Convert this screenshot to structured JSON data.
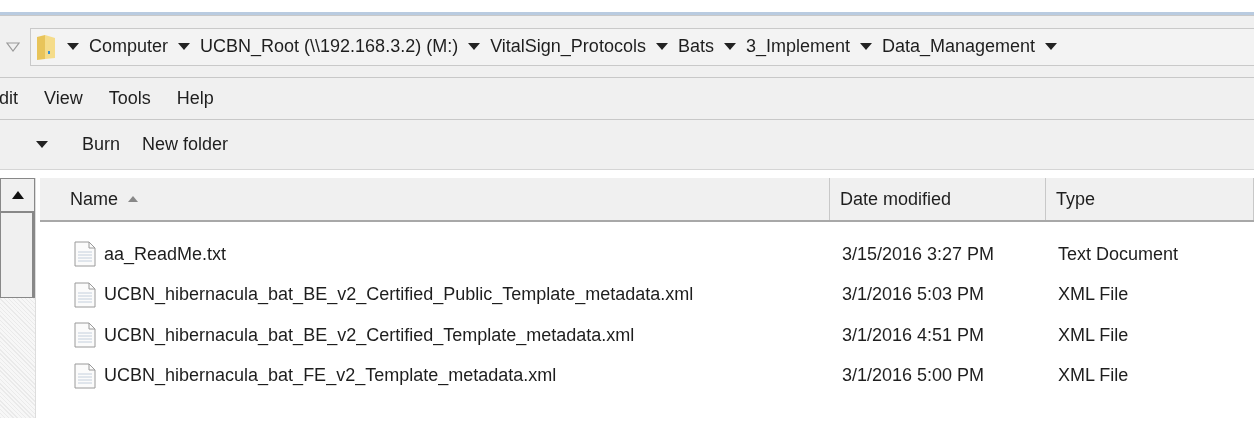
{
  "address_bar": {
    "breadcrumbs": [
      "Computer",
      "UCBN_Root (\\\\192.168.3.2) (M:)",
      "VitalSign_Protocols",
      "Bats",
      "3_Implement",
      "Data_Management"
    ]
  },
  "menu_bar": [
    "dit",
    "View",
    "Tools",
    "Help"
  ],
  "toolbar": [
    "Burn",
    "New folder"
  ],
  "file_list": {
    "columns": [
      {
        "label": "Name",
        "sorted": true
      },
      {
        "label": "Date modified",
        "sorted": false
      },
      {
        "label": "Type",
        "sorted": false
      }
    ],
    "rows": [
      {
        "name": "aa_ReadMe.txt",
        "date_modified": "3/15/2016 3:27 PM",
        "type": "Text Document"
      },
      {
        "name": "UCBN_hibernacula_bat_BE_v2_Certified_Public_Template_metadata.xml",
        "date_modified": "3/1/2016 5:03 PM",
        "type": "XML File"
      },
      {
        "name": "UCBN_hibernacula_bat_BE_v2_Certified_Template_metadata.xml",
        "date_modified": "3/1/2016 4:51 PM",
        "type": "XML File"
      },
      {
        "name": "UCBN_hibernacula_bat_FE_v2_Template_metadata.xml",
        "date_modified": "3/1/2016 5:00 PM",
        "type": "XML File"
      }
    ]
  }
}
